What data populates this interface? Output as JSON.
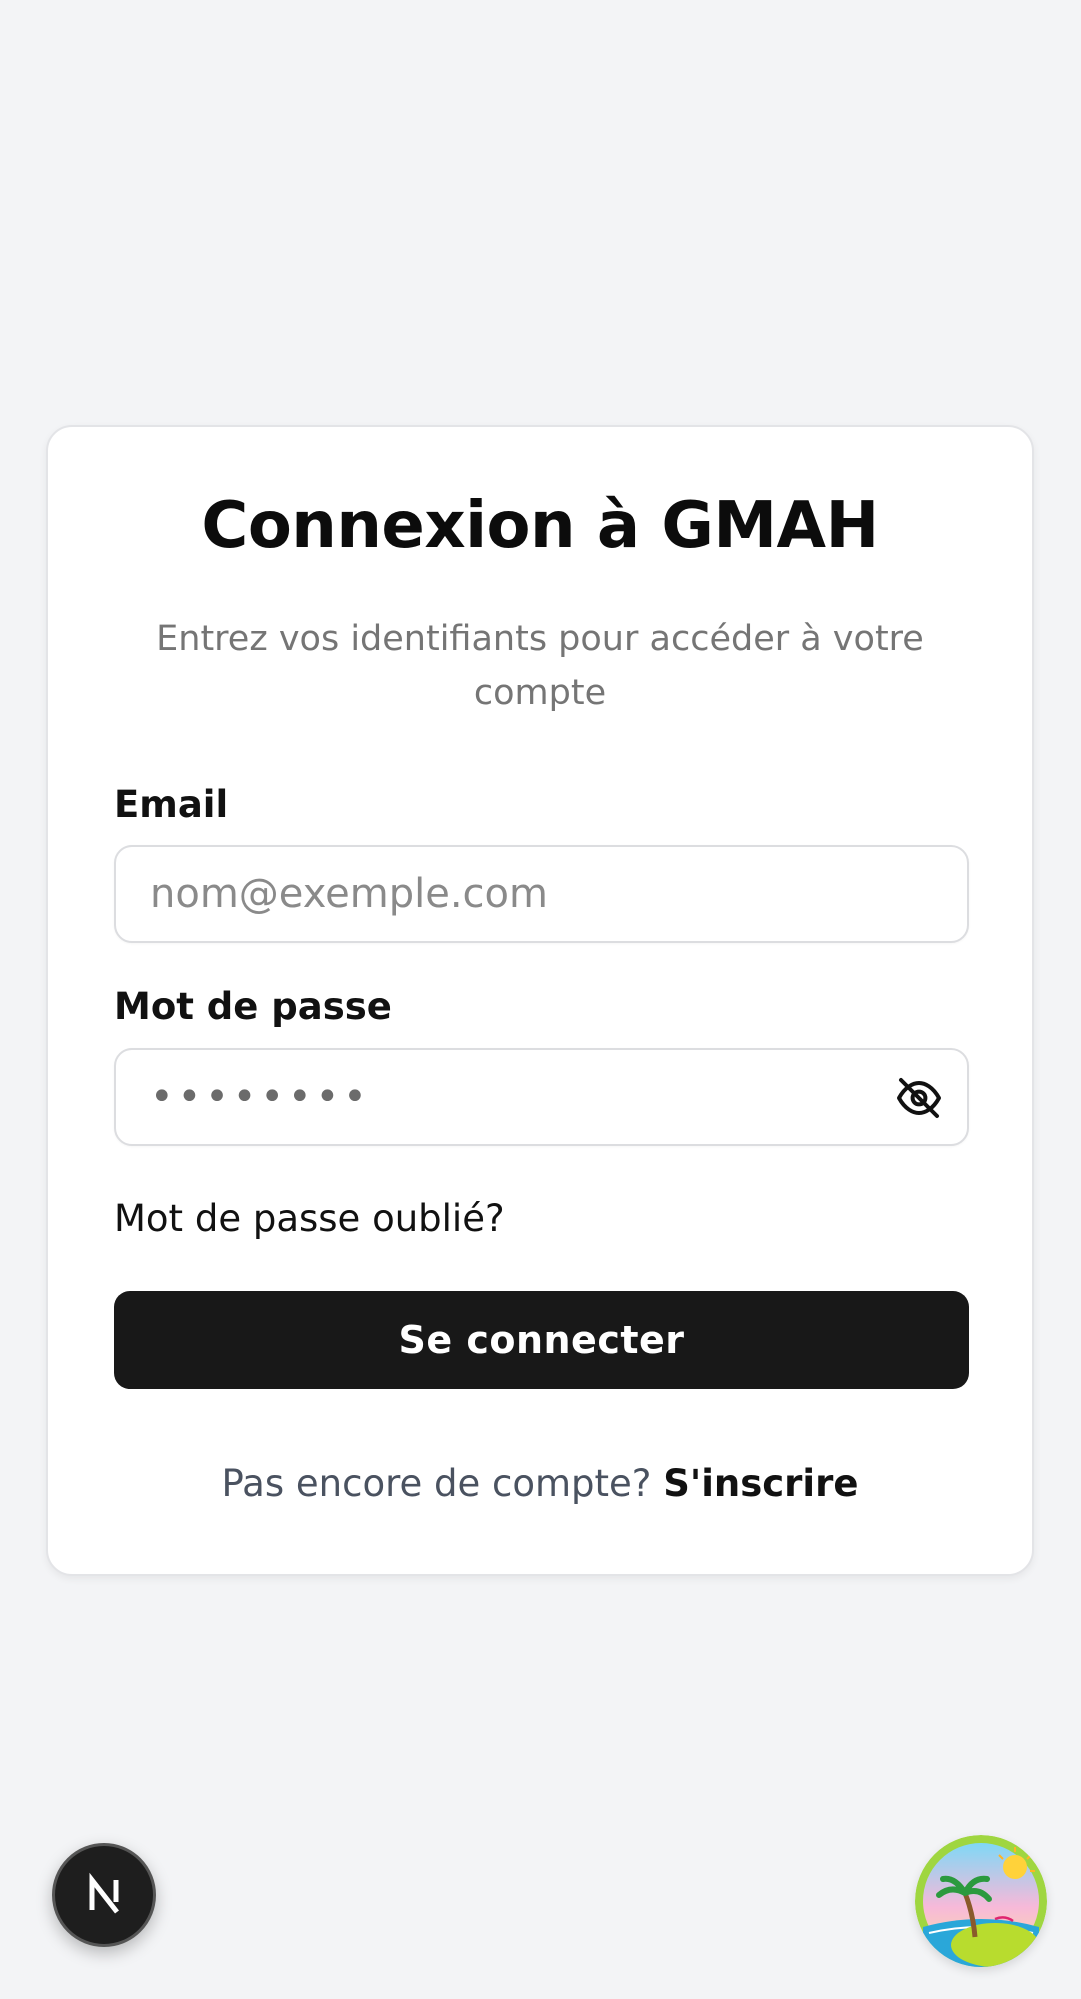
{
  "login": {
    "title": "Connexion à GMAH",
    "subtitle": "Entrez vos identifiants pour accéder à votre compte",
    "email": {
      "label": "Email",
      "placeholder": "nom@exemple.com",
      "value": ""
    },
    "password": {
      "label": "Mot de passe",
      "value": "••••••••",
      "toggle_icon": "eye-off-icon"
    },
    "forgot_password": "Mot de passe oublié?",
    "submit_label": "Se connecter",
    "signup_prompt": "Pas encore de compte?",
    "signup_link": "S'inscrire"
  },
  "overlays": {
    "dev_badge_icon": "nextjs-logo-icon",
    "avatar_icon": "beach-island-icon"
  },
  "colors": {
    "background": "#f3f4f6",
    "card": "#ffffff",
    "primary_button": "#181818",
    "muted_text": "#757575"
  }
}
